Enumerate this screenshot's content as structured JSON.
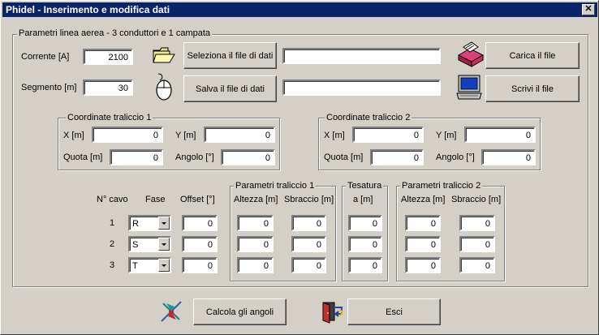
{
  "window": {
    "title": "Phidel - Inserimento e modifica dati",
    "close_glyph": "✕"
  },
  "main_group": {
    "title": "Parametri linea aerea - 3 conduttori e 1 campata"
  },
  "corrente": {
    "label": "Corrente [A]",
    "value": "2100"
  },
  "segmento": {
    "label": "Segmento [m]",
    "value": "30"
  },
  "buttons": {
    "seleziona": "Seleziona il file di dati",
    "salva": "Salva il file di dati",
    "carica": "Carica il file",
    "scrivi": "Scrivi il file",
    "calcola": "Calcola gli angoli",
    "esci": "Esci"
  },
  "file_paths": {
    "load": "",
    "save": ""
  },
  "traliccio1": {
    "title": "Coordinate traliccio 1",
    "x_label": "X [m]",
    "x": "0",
    "y_label": "Y [m]",
    "y": "0",
    "quota_label": "Quota [m]",
    "quota": "0",
    "angolo_label": "Angolo [°]",
    "angolo": "0"
  },
  "traliccio2": {
    "title": "Coordinate traliccio 2",
    "x_label": "X [m]",
    "x": "0",
    "y_label": "Y [m]",
    "y": "0",
    "quota_label": "Quota [m]",
    "quota": "0",
    "angolo_label": "Angolo [°]",
    "angolo": "0"
  },
  "cables": {
    "col_ncavo": "N° cavo",
    "col_fase": "Fase",
    "col_offset": "Offset [°]",
    "group_t1": "Parametri traliccio 1",
    "group_tesatura": "Tesatura",
    "group_t2": "Parametri traliccio 2",
    "col_altezza": "Altezza [m]",
    "col_sbraccio": "Sbraccio [m]",
    "col_a": "a [m]",
    "rows": [
      {
        "n": "1",
        "fase": "R",
        "offset": "0",
        "alt1": "0",
        "sbr1": "0",
        "a": "0",
        "alt2": "0",
        "sbr2": "0"
      },
      {
        "n": "2",
        "fase": "S",
        "offset": "0",
        "alt1": "0",
        "sbr1": "0",
        "a": "0",
        "alt2": "0",
        "sbr2": "0"
      },
      {
        "n": "3",
        "fase": "T",
        "offset": "0",
        "alt1": "0",
        "sbr1": "0",
        "a": "0",
        "alt2": "0",
        "sbr2": "0"
      }
    ]
  },
  "icons": {
    "folder": "folder-icon",
    "mouse": "mouse-icon",
    "drive": "disk-drive-icon",
    "monitor": "monitor-icon",
    "compass": "compass-icon",
    "exit": "exit-door-icon"
  }
}
